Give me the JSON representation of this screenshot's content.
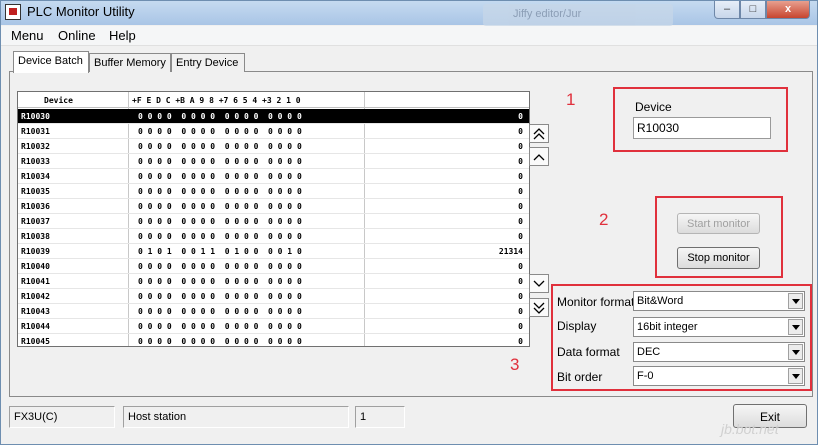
{
  "window": {
    "title": "PLC Monitor Utility",
    "background_tab_text": "Jiffy editor/Jur",
    "min": "–",
    "max": "□",
    "close": "x"
  },
  "menu": [
    "Menu",
    "Online",
    "Help"
  ],
  "tabs": [
    "Device Batch",
    "Buffer Memory",
    "Entry Device"
  ],
  "grid": {
    "header_device": "Device",
    "header_bits": "+F E D C +B A 9 8 +7 6 5 4 +3 2 1 0",
    "rows": [
      {
        "device": "R10030",
        "bits": "0 0 0 0  0 0 0 0  0 0 0 0  0 0 0 0",
        "value": "0"
      },
      {
        "device": "R10031",
        "bits": "0 0 0 0  0 0 0 0  0 0 0 0  0 0 0 0",
        "value": "0"
      },
      {
        "device": "R10032",
        "bits": "0 0 0 0  0 0 0 0  0 0 0 0  0 0 0 0",
        "value": "0"
      },
      {
        "device": "R10033",
        "bits": "0 0 0 0  0 0 0 0  0 0 0 0  0 0 0 0",
        "value": "0"
      },
      {
        "device": "R10034",
        "bits": "0 0 0 0  0 0 0 0  0 0 0 0  0 0 0 0",
        "value": "0"
      },
      {
        "device": "R10035",
        "bits": "0 0 0 0  0 0 0 0  0 0 0 0  0 0 0 0",
        "value": "0"
      },
      {
        "device": "R10036",
        "bits": "0 0 0 0  0 0 0 0  0 0 0 0  0 0 0 0",
        "value": "0"
      },
      {
        "device": "R10037",
        "bits": "0 0 0 0  0 0 0 0  0 0 0 0  0 0 0 0",
        "value": "0"
      },
      {
        "device": "R10038",
        "bits": "0 0 0 0  0 0 0 0  0 0 0 0  0 0 0 0",
        "value": "0"
      },
      {
        "device": "R10039",
        "bits": "0 1 0 1  0 0 1 1  0 1 0 0  0 0 1 0",
        "value": "21314"
      },
      {
        "device": "R10040",
        "bits": "0 0 0 0  0 0 0 0  0 0 0 0  0 0 0 0",
        "value": "0"
      },
      {
        "device": "R10041",
        "bits": "0 0 0 0  0 0 0 0  0 0 0 0  0 0 0 0",
        "value": "0"
      },
      {
        "device": "R10042",
        "bits": "0 0 0 0  0 0 0 0  0 0 0 0  0 0 0 0",
        "value": "0"
      },
      {
        "device": "R10043",
        "bits": "0 0 0 0  0 0 0 0  0 0 0 0  0 0 0 0",
        "value": "0"
      },
      {
        "device": "R10044",
        "bits": "0 0 0 0  0 0 0 0  0 0 0 0  0 0 0 0",
        "value": "0"
      },
      {
        "device": "R10045",
        "bits": "0 0 0 0  0 0 0 0  0 0 0 0  0 0 0 0",
        "value": "0"
      }
    ]
  },
  "annotations": [
    "1",
    "2",
    "3"
  ],
  "device": {
    "label": "Device",
    "value": "R10030"
  },
  "monitor": {
    "start_label": "Start monitor",
    "stop_label": "Stop monitor"
  },
  "settings": [
    {
      "label": "Monitor format",
      "value": "Bit&Word"
    },
    {
      "label": "Display",
      "value": "16bit integer"
    },
    {
      "label": "Data format",
      "value": "DEC"
    },
    {
      "label": "Bit order",
      "value": "F-0"
    }
  ],
  "status": {
    "plc_type": "FX3U(C)",
    "station": "Host station",
    "number": "1"
  },
  "exit_label": "Exit",
  "watermark": "jb.bot.net",
  "colors": {
    "annotation": "#e0303c",
    "selected_row": "#000000"
  }
}
